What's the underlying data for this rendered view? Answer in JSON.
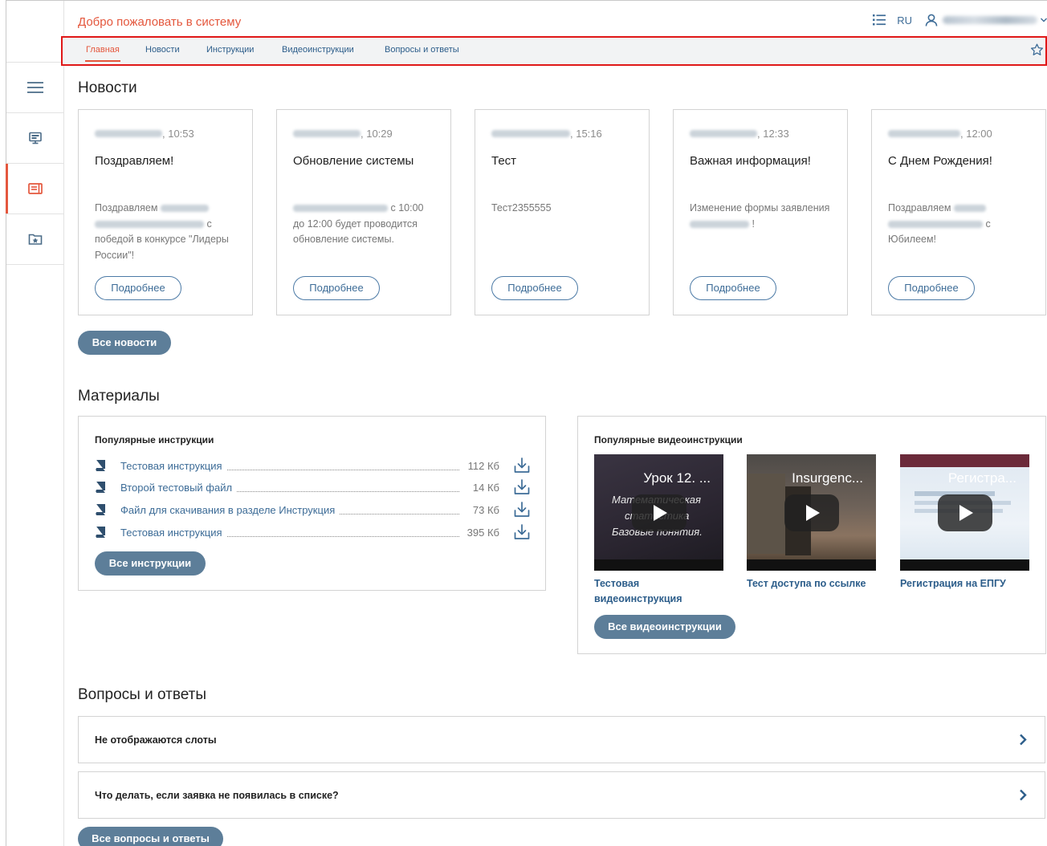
{
  "header": {
    "welcome": "Добро пожаловать в систему",
    "lang": "RU"
  },
  "tabs": [
    {
      "label": "Главная",
      "active": true
    },
    {
      "label": "Новости"
    },
    {
      "label": "Инструкции"
    },
    {
      "label": "Видеоинструкции"
    },
    {
      "label": "Вопросы и ответы"
    }
  ],
  "sidebar": {
    "icons": [
      "menu-icon",
      "monitor-icon",
      "news-icon",
      "favorites-icon"
    ],
    "active": "news-icon"
  },
  "news": {
    "heading": "Новости",
    "more_label": "Подробнее",
    "all_label": "Все новости",
    "items": [
      {
        "time": ", 10:53",
        "title": "Поздравляем!",
        "text_a": "Поздравляем",
        "text_b": "с",
        "text_c": "победой в конкурсе \"Лидеры России\"!"
      },
      {
        "time": ", 10:29",
        "title": "Обновление системы",
        "text_a": "с 10:00",
        "text_b": "до 12:00 будет проводится обновление системы."
      },
      {
        "time": ", 15:16",
        "title": "Тест",
        "text_a": "Тест2355555"
      },
      {
        "time": ", 12:33",
        "title": "Важная информация!",
        "text_a": "Изменение формы заявления",
        "text_b": "!"
      },
      {
        "time": ", 12:00",
        "title": "С Днем Рождения!",
        "text_a": "Поздравляем",
        "text_b": "с",
        "text_c": "Юбилеем!"
      }
    ]
  },
  "materials": {
    "heading": "Материалы",
    "instructions": {
      "title": "Популярные инструкции",
      "all_label": "Все инструкции",
      "rows": [
        {
          "name": "Тестовая инструкция",
          "size": "112 Кб"
        },
        {
          "name": "Второй тестовый файл",
          "size": "14 Кб"
        },
        {
          "name": "Файл для скачивания в разделе Инструкция",
          "size": "73 Кб"
        },
        {
          "name": "Тестовая инструкция",
          "size": "395 Кб"
        }
      ]
    },
    "videos": {
      "title": "Популярные видеоинструкции",
      "all_label": "Все видеоинструкции",
      "items": [
        {
          "thumb_title": "Урок 12. ...",
          "overlay_1": "Математическая",
          "overlay_2": "статистика",
          "overlay_3": "Базовые понятия.",
          "caption": "Тестовая видеоинструкция"
        },
        {
          "thumb_title": "Insurgenc...",
          "caption": "Тест доступа по ссылке"
        },
        {
          "thumb_title": "Регистра...",
          "caption": "Регистрация на ЕПГУ"
        }
      ]
    }
  },
  "faq": {
    "heading": "Вопросы и ответы",
    "all_label": "Все вопросы и ответы",
    "items": [
      {
        "question": "Не отображаются слоты"
      },
      {
        "question": "Что делать, если заявка не появилась в списке?"
      }
    ]
  }
}
